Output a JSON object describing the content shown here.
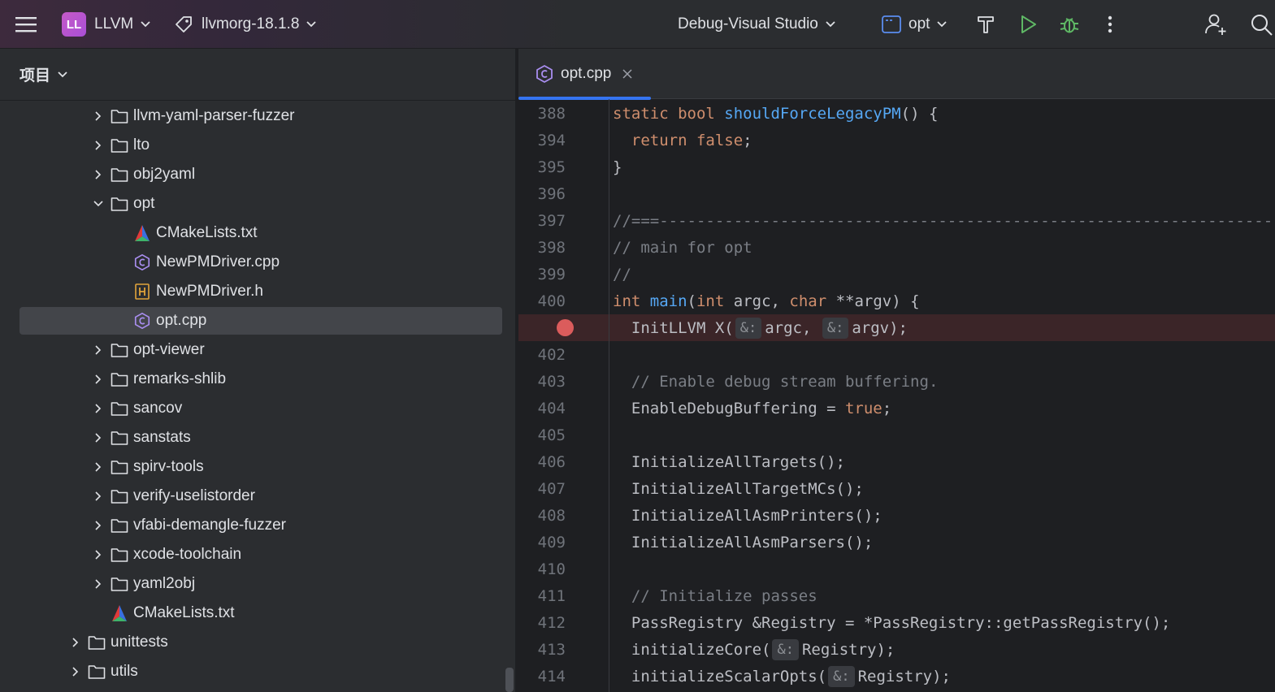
{
  "titlebar": {
    "project_badge": "LL",
    "project_name": "LLVM",
    "vcs_branch": "llvmorg-18.1.8",
    "run_config": "Debug-Visual Studio",
    "target": "opt"
  },
  "project_panel": {
    "title": "项目",
    "tree": [
      {
        "label": "llvm-yaml-parser-fuzzer",
        "type": "folder",
        "indent": 2,
        "expanded": false
      },
      {
        "label": "lto",
        "type": "folder",
        "indent": 2,
        "expanded": false
      },
      {
        "label": "obj2yaml",
        "type": "folder",
        "indent": 2,
        "expanded": false
      },
      {
        "label": "opt",
        "type": "folder",
        "indent": 2,
        "expanded": true
      },
      {
        "label": "CMakeLists.txt",
        "type": "cmake",
        "indent": 3
      },
      {
        "label": "NewPMDriver.cpp",
        "type": "cpp",
        "indent": 3
      },
      {
        "label": "NewPMDriver.h",
        "type": "header",
        "indent": 3
      },
      {
        "label": "opt.cpp",
        "type": "cpp",
        "indent": 3,
        "selected": true
      },
      {
        "label": "opt-viewer",
        "type": "folder",
        "indent": 2,
        "expanded": false
      },
      {
        "label": "remarks-shlib",
        "type": "folder",
        "indent": 2,
        "expanded": false
      },
      {
        "label": "sancov",
        "type": "folder",
        "indent": 2,
        "expanded": false
      },
      {
        "label": "sanstats",
        "type": "folder",
        "indent": 2,
        "expanded": false
      },
      {
        "label": "spirv-tools",
        "type": "folder",
        "indent": 2,
        "expanded": false
      },
      {
        "label": "verify-uselistorder",
        "type": "folder",
        "indent": 2,
        "expanded": false
      },
      {
        "label": "vfabi-demangle-fuzzer",
        "type": "folder",
        "indent": 2,
        "expanded": false
      },
      {
        "label": "xcode-toolchain",
        "type": "folder",
        "indent": 2,
        "expanded": false
      },
      {
        "label": "yaml2obj",
        "type": "folder",
        "indent": 2,
        "expanded": false
      },
      {
        "label": "CMakeLists.txt",
        "type": "cmake",
        "indent": 2
      },
      {
        "label": "unittests",
        "type": "folder",
        "indent": 1,
        "expanded": false
      },
      {
        "label": "utils",
        "type": "folder",
        "indent": 1,
        "expanded": false
      }
    ]
  },
  "editor": {
    "tab": {
      "label": "opt.cpp"
    },
    "lines": [
      {
        "num": "388",
        "tokens": [
          [
            "kw",
            "static "
          ],
          [
            "kw",
            "bool "
          ],
          [
            "fn",
            "shouldForceLegacyPM"
          ],
          [
            "code",
            "() {"
          ]
        ]
      },
      {
        "num": "394",
        "tokens": [
          [
            "code",
            "  "
          ],
          [
            "kw",
            "return "
          ],
          [
            "kw",
            "false"
          ],
          [
            "code",
            ";"
          ]
        ]
      },
      {
        "num": "395",
        "tokens": [
          [
            "code",
            "}"
          ]
        ]
      },
      {
        "num": "396",
        "tokens": []
      },
      {
        "num": "397",
        "tokens": [
          [
            "cm",
            "//===------------------------------------------------------------------"
          ]
        ]
      },
      {
        "num": "398",
        "tokens": [
          [
            "cm",
            "// main for opt"
          ]
        ]
      },
      {
        "num": "399",
        "tokens": [
          [
            "cm",
            "//"
          ]
        ]
      },
      {
        "num": "400",
        "tokens": [
          [
            "kw",
            "int "
          ],
          [
            "fn",
            "main"
          ],
          [
            "code",
            "("
          ],
          [
            "kw",
            "int "
          ],
          [
            "code",
            "argc, "
          ],
          [
            "kw",
            "char "
          ],
          [
            "code",
            "**argv) {"
          ]
        ]
      },
      {
        "num": "",
        "breakpoint": true,
        "tokens": [
          [
            "code",
            "  InitLLVM X("
          ],
          [
            "hint",
            "&:"
          ],
          [
            "code",
            "argc, "
          ],
          [
            "hint",
            "&:"
          ],
          [
            "code",
            "argv);"
          ]
        ]
      },
      {
        "num": "402",
        "tokens": []
      },
      {
        "num": "403",
        "tokens": [
          [
            "code",
            "  "
          ],
          [
            "cm",
            "// Enable debug stream buffering."
          ]
        ]
      },
      {
        "num": "404",
        "tokens": [
          [
            "code",
            "  EnableDebugBuffering = "
          ],
          [
            "kw",
            "true"
          ],
          [
            "code",
            ";"
          ]
        ]
      },
      {
        "num": "405",
        "tokens": []
      },
      {
        "num": "406",
        "tokens": [
          [
            "code",
            "  InitializeAllTargets();"
          ]
        ]
      },
      {
        "num": "407",
        "tokens": [
          [
            "code",
            "  InitializeAllTargetMCs();"
          ]
        ]
      },
      {
        "num": "408",
        "tokens": [
          [
            "code",
            "  InitializeAllAsmPrinters();"
          ]
        ]
      },
      {
        "num": "409",
        "tokens": [
          [
            "code",
            "  InitializeAllAsmParsers();"
          ]
        ]
      },
      {
        "num": "410",
        "tokens": []
      },
      {
        "num": "411",
        "tokens": [
          [
            "code",
            "  "
          ],
          [
            "cm",
            "// Initialize passes"
          ]
        ]
      },
      {
        "num": "412",
        "tokens": [
          [
            "code",
            "  PassRegistry &Registry = *PassRegistry::getPassRegistry();"
          ]
        ]
      },
      {
        "num": "413",
        "tokens": [
          [
            "code",
            "  initializeCore("
          ],
          [
            "hint",
            "&:"
          ],
          [
            "code",
            "Registry);"
          ]
        ]
      },
      {
        "num": "414",
        "tokens": [
          [
            "code",
            "  initializeScalarOpts("
          ],
          [
            "hint",
            "&:"
          ],
          [
            "code",
            "Registry);"
          ]
        ]
      }
    ]
  },
  "colors": {
    "accent": "#3574f0",
    "breakpoint": "#db5c5c",
    "run": "#5fb865",
    "keyword": "#cf8e6d",
    "function": "#56a8f5"
  }
}
